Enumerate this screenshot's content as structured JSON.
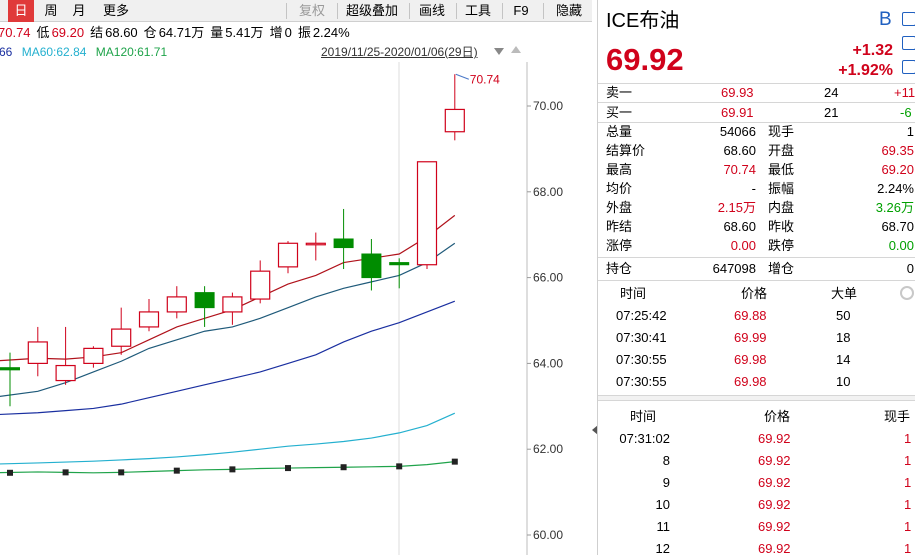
{
  "toolbar": {
    "items": [
      {
        "label": "日",
        "selected": true
      },
      {
        "label": "周"
      },
      {
        "label": "月"
      },
      {
        "label": "更多"
      },
      {
        "label": "复权",
        "disabled": true
      },
      {
        "label": "超级叠加"
      },
      {
        "label": "画线"
      },
      {
        "label": "工具"
      },
      {
        "label": "F9"
      },
      {
        "label": "隐藏"
      }
    ]
  },
  "ohlc_bar": {
    "high_value": "70.74",
    "low_label": "低",
    "low_value": "69.20",
    "settle_label": "结",
    "settle_value": "68.60",
    "oi_label": "仓",
    "oi_value": "64.71万",
    "vol_label": "量",
    "vol_value": "5.41万",
    "inc_label": "增",
    "inc_value": "0",
    "amp_label": "振",
    "amp_value": "2.24%"
  },
  "ma_bar": {
    "ma_partial": "66",
    "ma60": "MA60:62.84",
    "ma120": "MA120:61.71",
    "date_range": "2019/11/25-2020/01/06(29日)"
  },
  "chart_data": {
    "type": "candlestick",
    "y_ticks": [
      "70.00",
      "68.00",
      "66.00",
      "64.00",
      "62.00",
      "60.00"
    ],
    "ylim": [
      59.6,
      71.3
    ],
    "high_annotation": "70.74",
    "colors": {
      "up": "#d0021b",
      "down": "#008c00",
      "ma5": "#b0121b",
      "ma10": "#1f5a7a",
      "ma20": "#1a2fa0",
      "ma60": "#24b0cf",
      "ma120": "#1fa34a"
    },
    "candles": [
      {
        "o": 63.9,
        "h": 64.25,
        "l": 63.0,
        "c": 63.85
      },
      {
        "o": 64.0,
        "h": 64.85,
        "l": 63.7,
        "c": 64.5
      },
      {
        "o": 63.6,
        "h": 64.85,
        "l": 63.5,
        "c": 63.95
      },
      {
        "o": 64.0,
        "h": 64.4,
        "l": 63.9,
        "c": 64.35
      },
      {
        "o": 64.4,
        "h": 65.3,
        "l": 64.2,
        "c": 64.8
      },
      {
        "o": 64.85,
        "h": 65.5,
        "l": 64.75,
        "c": 65.2
      },
      {
        "o": 65.2,
        "h": 65.8,
        "l": 65.05,
        "c": 65.55
      },
      {
        "o": 65.65,
        "h": 65.8,
        "l": 64.85,
        "c": 65.3
      },
      {
        "o": 65.2,
        "h": 65.65,
        "l": 64.9,
        "c": 65.55
      },
      {
        "o": 65.5,
        "h": 66.4,
        "l": 65.4,
        "c": 66.15
      },
      {
        "o": 66.25,
        "h": 66.85,
        "l": 66.1,
        "c": 66.8
      },
      {
        "o": 66.8,
        "h": 67.05,
        "l": 66.4,
        "c": 66.8
      },
      {
        "o": 66.9,
        "h": 67.6,
        "l": 66.2,
        "c": 66.7
      },
      {
        "o": 66.55,
        "h": 66.9,
        "l": 65.7,
        "c": 66.0
      },
      {
        "o": 66.35,
        "h": 66.45,
        "l": 65.75,
        "c": 66.3
      },
      {
        "o": 66.3,
        "h": 67.0,
        "l": 66.2,
        "c": 68.7
      },
      {
        "o": 69.4,
        "h": 70.74,
        "l": 69.2,
        "c": 69.92
      }
    ],
    "ma5": [
      64.05,
      64.12,
      64.1,
      64.15,
      64.25,
      64.55,
      64.85,
      65.05,
      65.25,
      65.55,
      65.85,
      66.05,
      66.35,
      66.45,
      66.55,
      66.95,
      67.45
    ],
    "ma10": [
      63.2,
      63.35,
      63.55,
      63.8,
      64.05,
      64.35,
      64.55,
      64.75,
      64.85,
      65.05,
      65.3,
      65.55,
      65.75,
      65.9,
      66.05,
      66.35,
      66.8
    ],
    "ma20": [
      62.8,
      62.85,
      62.9,
      62.95,
      63.05,
      63.2,
      63.35,
      63.5,
      63.65,
      63.8,
      64.0,
      64.2,
      64.5,
      64.75,
      64.95,
      65.2,
      65.45
    ],
    "ma60": [
      61.65,
      61.68,
      61.7,
      61.72,
      61.75,
      61.78,
      61.82,
      61.87,
      61.93,
      62.0,
      62.07,
      62.12,
      62.18,
      62.26,
      62.38,
      62.55,
      62.84
    ],
    "ma120": [
      61.45,
      61.47,
      61.46,
      61.45,
      61.46,
      61.48,
      61.5,
      61.52,
      61.53,
      61.55,
      61.56,
      61.57,
      61.58,
      61.59,
      61.6,
      61.64,
      61.71
    ]
  },
  "quote": {
    "symbol": "ICE布油",
    "badge": "B",
    "price": "69.92",
    "change": "+1.32",
    "change_pct": "+1.92%",
    "ask": {
      "label": "卖一",
      "price": "69.93",
      "qty": "24",
      "chg": "+11"
    },
    "bid": {
      "label": "买一",
      "price": "69.91",
      "qty": "21",
      "chg": "-6"
    },
    "stats": [
      {
        "l1": "总量",
        "v1": "54066",
        "c1": "black",
        "l2": "现手",
        "v2": "1",
        "c2": "black"
      },
      {
        "l1": "结算价",
        "v1": "68.60",
        "c1": "black",
        "l2": "开盘",
        "v2": "69.35",
        "c2": "red"
      },
      {
        "l1": "最高",
        "v1": "70.74",
        "c1": "red",
        "l2": "最低",
        "v2": "69.20",
        "c2": "red"
      },
      {
        "l1": "均价",
        "v1": "-",
        "c1": "black",
        "l2": "振幅",
        "v2": "2.24%",
        "c2": "black"
      },
      {
        "l1": "外盘",
        "v1": "2.15万",
        "c1": "red",
        "l2": "内盘",
        "v2": "3.26万",
        "c2": "green"
      },
      {
        "l1": "昨结",
        "v1": "68.60",
        "c1": "black",
        "l2": "昨收",
        "v2": "68.70",
        "c2": "black"
      },
      {
        "l1": "涨停",
        "v1": "0.00",
        "c1": "red",
        "l2": "跌停",
        "v2": "0.00",
        "c2": "green"
      }
    ],
    "oi": {
      "l1": "持仓",
      "v1": "647098",
      "l2": "增仓",
      "v2": "0"
    }
  },
  "trades_big": {
    "headers": [
      "时间",
      "价格",
      "大单"
    ],
    "rows": [
      {
        "time": "07:25:42",
        "price": "69.88",
        "qty": "50"
      },
      {
        "time": "07:30:41",
        "price": "69.99",
        "qty": "18"
      },
      {
        "time": "07:30:55",
        "price": "69.98",
        "qty": "14"
      },
      {
        "time": "07:30:55",
        "price": "69.98",
        "qty": "10"
      }
    ]
  },
  "ticks": {
    "headers": [
      "时间",
      "价格",
      "现手"
    ],
    "rows": [
      {
        "time": "07:31:02",
        "price": "69.92",
        "qty": "1"
      },
      {
        "time": "8",
        "price": "69.92",
        "qty": "1"
      },
      {
        "time": "9",
        "price": "69.92",
        "qty": "1"
      },
      {
        "time": "10",
        "price": "69.92",
        "qty": "1"
      },
      {
        "time": "11",
        "price": "69.92",
        "qty": "1"
      },
      {
        "time": "12",
        "price": "69.92",
        "qty": "1"
      }
    ]
  }
}
